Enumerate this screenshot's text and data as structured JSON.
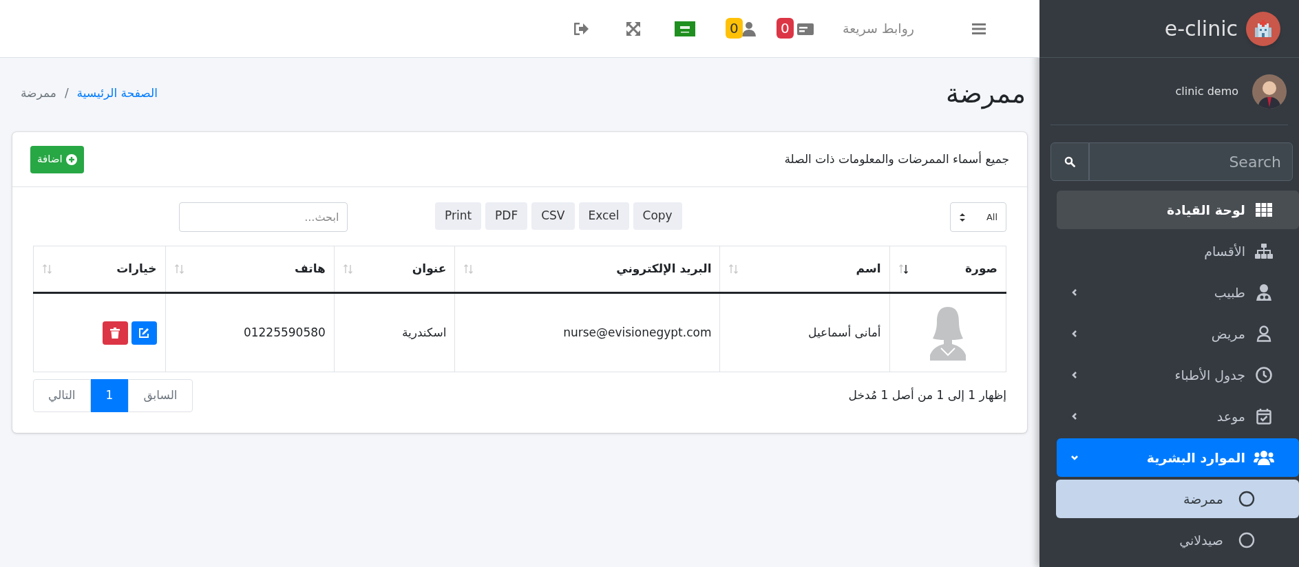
{
  "brand": {
    "name": "e-clinic"
  },
  "user": {
    "name": "clinic demo"
  },
  "sidebar": {
    "search": {
      "placeholder": "Search"
    },
    "items": [
      {
        "label": "لوحة القيادة",
        "hovered": true,
        "selected": false,
        "has_submenu": false
      },
      {
        "label": "الأقسام",
        "hovered": false,
        "selected": false,
        "has_submenu": false
      },
      {
        "label": "طبيب",
        "hovered": false,
        "selected": false,
        "has_submenu": true,
        "expanded": false
      },
      {
        "label": "مريض",
        "hovered": false,
        "selected": false,
        "has_submenu": true,
        "expanded": false
      },
      {
        "label": "جدول الأطباء",
        "hovered": false,
        "selected": false,
        "has_submenu": true,
        "expanded": false
      },
      {
        "label": "موعد",
        "hovered": false,
        "selected": false,
        "has_submenu": true,
        "expanded": false
      },
      {
        "label": "الموارد البشرية",
        "hovered": false,
        "selected": true,
        "has_submenu": true,
        "expanded": true,
        "children": [
          {
            "label": "ممرضة",
            "selected": true
          },
          {
            "label": "صيدلاني",
            "selected": false
          }
        ]
      }
    ]
  },
  "topbar": {
    "quick_links": "روابط سريعة",
    "badges": [
      {
        "count": "0",
        "color": "#dc3545"
      },
      {
        "count": "0",
        "color": "#ffc107"
      }
    ]
  },
  "page": {
    "title": "ممرضة",
    "breadcrumb_separator": "/",
    "breadcrumb": [
      {
        "label": "الصفحة الرئيسية",
        "kind": "link"
      },
      {
        "label": "ممرضة",
        "kind": "current"
      }
    ]
  },
  "card": {
    "title": "جميع أسماء الممرضات والمعلومات ذات الصلة",
    "add_button": "اضافة"
  },
  "table_tools": {
    "length": "All",
    "export_buttons": [
      "Copy",
      "Excel",
      "CSV",
      "PDF",
      "Print"
    ],
    "search": {
      "placeholder": "ابحث..."
    }
  },
  "table": {
    "columns": [
      {
        "label": "صورة",
        "sorted": true
      },
      {
        "label": "اسم",
        "sorted": false
      },
      {
        "label": "البريد الإلكتروني",
        "sorted": false
      },
      {
        "label": "عنوان",
        "sorted": false
      },
      {
        "label": "هاتف",
        "sorted": false
      },
      {
        "label": "خيارات",
        "sorted": false
      }
    ],
    "rows": [
      {
        "name": "أمانى أسماعيل",
        "email": "nurse@evisionegypt.com",
        "address": "اسكندرية",
        "phone": "01225590580"
      }
    ]
  },
  "footer": {
    "info": "إظهار 1 إلى 1 من أصل 1 مُدخل",
    "pagination": [
      {
        "label": "السابق",
        "selected": false
      },
      {
        "label": "1",
        "selected": true
      },
      {
        "label": "التالي",
        "selected": false
      }
    ]
  }
}
